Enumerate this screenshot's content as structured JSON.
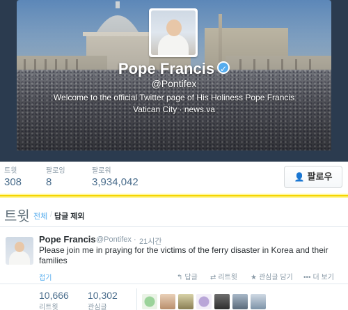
{
  "profile": {
    "name": "Pope Francis",
    "handle": "@Pontifex",
    "bio": "Welcome to the official Twitter page of His Holiness Pope Francis",
    "location_line": "Vatican City · news.va"
  },
  "stats": [
    {
      "label": "트윗",
      "value": "308"
    },
    {
      "label": "팔로잉",
      "value": "8"
    },
    {
      "label": "팔로워",
      "value": "3,934,042"
    }
  ],
  "follow_label": "팔로우",
  "tweets_header": {
    "title": "트윗",
    "filter_all": "전체",
    "filter_sep": "/",
    "filter_noreply": "답글 제외"
  },
  "tweet": {
    "name": "Pope Francis",
    "handle": "@Pontifex",
    "dot": "·",
    "time": "21시간",
    "text": "Please join me in praying for the victims of the ferry disaster in Korea and their families",
    "expand": "접기",
    "actions": {
      "reply": "답글",
      "retweet": "리트윗",
      "favorite": "관심글 담기",
      "more": "더 보기"
    }
  },
  "counts": [
    {
      "value": "10,666",
      "label": "리트윗"
    },
    {
      "value": "10,302",
      "label": "관심글"
    }
  ],
  "colors": {
    "accent": "#55acee",
    "stat_number": "#4a6d8c",
    "highlight_bar": "#f5d400"
  }
}
